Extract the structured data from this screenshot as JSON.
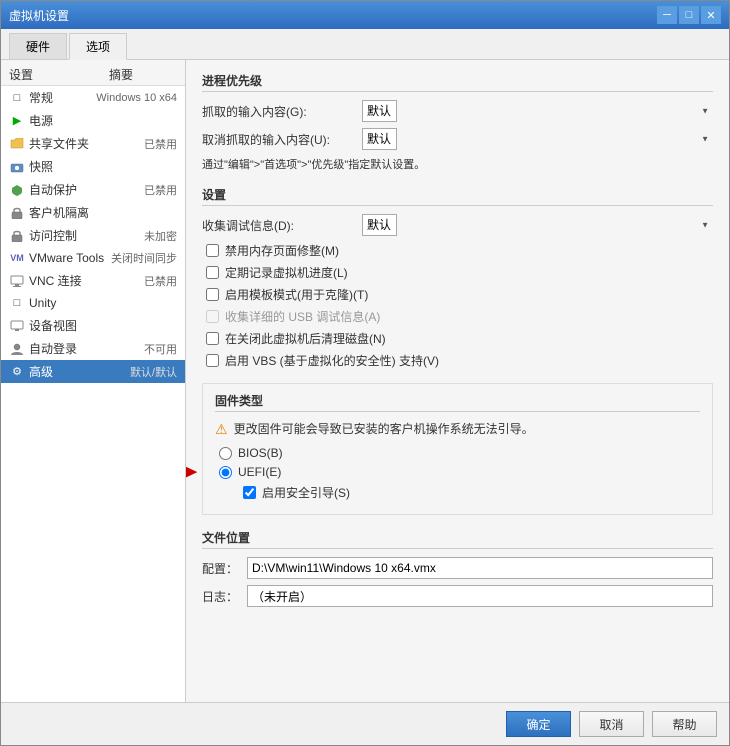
{
  "window": {
    "title": "虚拟机设置",
    "close_btn": "✕",
    "min_btn": "─",
    "max_btn": "□"
  },
  "tabs": [
    {
      "id": "hardware",
      "label": "硬件"
    },
    {
      "id": "options",
      "label": "选项",
      "active": true
    }
  ],
  "left_panel": {
    "col1": "设置",
    "col2": "摘要",
    "items": [
      {
        "id": "general",
        "icon": "□",
        "name": "常规",
        "value": "Windows 10 x64"
      },
      {
        "id": "power",
        "icon": "▶",
        "name": "电源",
        "value": ""
      },
      {
        "id": "shared-folders",
        "icon": "📁",
        "name": "共享文件夹",
        "value": "已禁用"
      },
      {
        "id": "snapshot",
        "icon": "📷",
        "name": "快照",
        "value": ""
      },
      {
        "id": "autoprotect",
        "icon": "🔄",
        "name": "自动保护",
        "value": "已禁用"
      },
      {
        "id": "guest-isolation",
        "icon": "🔒",
        "name": "客户机隔离",
        "value": ""
      },
      {
        "id": "access-control",
        "icon": "🔑",
        "name": "访问控制",
        "value": "未加密"
      },
      {
        "id": "vmware-tools",
        "icon": "VM",
        "name": "VMware Tools",
        "value": "关闭时间同步"
      },
      {
        "id": "vnc",
        "icon": "📡",
        "name": "VNC 连接",
        "value": "已禁用"
      },
      {
        "id": "unity",
        "icon": "□",
        "name": "Unity",
        "value": ""
      },
      {
        "id": "device-view",
        "icon": "🖥",
        "name": "设备视图",
        "value": ""
      },
      {
        "id": "auto-login",
        "icon": "👤",
        "name": "自动登录",
        "value": "不可用"
      },
      {
        "id": "advanced",
        "icon": "⚙",
        "name": "高级",
        "value": "默认/默认",
        "selected": true
      }
    ]
  },
  "right_panel": {
    "sections": {
      "priority": {
        "title": "进程优先级",
        "capture_label": "抓取的输入内容(G):",
        "capture_value": "默认",
        "uncapture_label": "取消抓取的输入内容(U):",
        "uncapture_value": "默认",
        "note": "通过\"编辑\">\"首选项\">\"优先级\"指定默认设置。"
      },
      "settings": {
        "title": "设置",
        "debug_label": "收集调试信息(D):",
        "debug_value": "默认",
        "checkboxes": [
          {
            "id": "disable-page-trim",
            "label": "禁用内存页面修整(M)",
            "checked": false
          },
          {
            "id": "log-progress",
            "label": "定期记录虚拟机进度(L)",
            "checked": false
          },
          {
            "id": "template-mode",
            "label": "启用模板模式(用于克隆)(T)",
            "checked": false
          },
          {
            "id": "usb-debug",
            "label": "收集详细的 USB 调试信息(A)",
            "checked": false,
            "disabled": true
          },
          {
            "id": "clean-disk",
            "label": "在关闭此虚拟机后清理磁盘(N)",
            "checked": false
          },
          {
            "id": "vbs",
            "label": "启用 VBS (基于虚拟化的安全性) 支持(V)",
            "checked": false
          }
        ]
      },
      "firmware": {
        "title": "固件类型",
        "warning": "更改固件可能会导致已安装的客户机操作系统无法引导。",
        "radios": [
          {
            "id": "bios",
            "label": "BIOS(B)",
            "checked": false
          },
          {
            "id": "uefi",
            "label": "UEFI(E)",
            "checked": true
          }
        ],
        "secure_boot": {
          "label": "启用安全引导(S)",
          "checked": true
        }
      },
      "file_location": {
        "title": "文件位置",
        "config_label": "配置：",
        "config_value": "D:\\VM\\win11\\Windows 10 x64.vmx",
        "log_label": "日志：",
        "log_value": "（未开启）"
      }
    }
  },
  "bottom_buttons": {
    "ok": "确定",
    "cancel": "取消",
    "help": "帮助"
  }
}
